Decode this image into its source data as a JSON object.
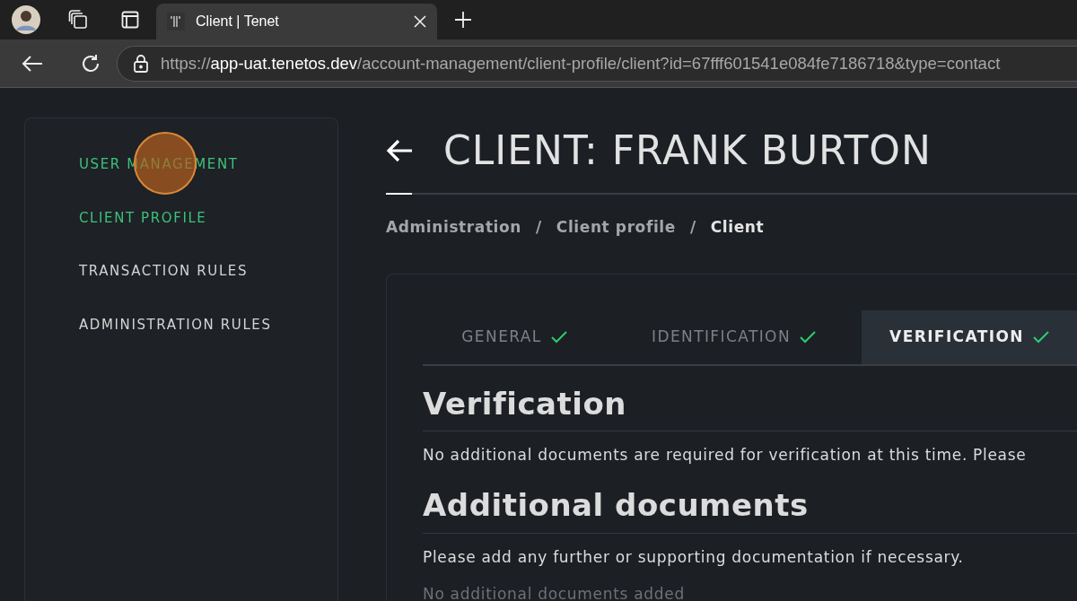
{
  "browser": {
    "tab_title": "Client | Tenet",
    "url": {
      "scheme": "https://",
      "host": "app-uat.tenetos.dev",
      "path": "/account-management/client-profile/client?id=67fff601541e084fe7186718&type=contact"
    }
  },
  "sidebar": {
    "items": [
      {
        "label": "USER MANAGEMENT",
        "selected": true
      },
      {
        "label": "CLIENT PROFILE",
        "selected": true
      },
      {
        "label": "TRANSACTION RULES",
        "selected": false
      },
      {
        "label": "ADMINISTRATION RULES",
        "selected": false
      }
    ]
  },
  "page": {
    "title": "CLIENT: FRANK BURTON",
    "breadcrumb": [
      {
        "label": "Administration",
        "selected": false
      },
      {
        "label": "Client profile",
        "selected": false
      },
      {
        "label": "Client",
        "selected": true
      }
    ],
    "separator": "/"
  },
  "tabs": [
    {
      "label": "GENERAL",
      "selected": false,
      "checked": true
    },
    {
      "label": "IDENTIFICATION",
      "selected": false,
      "checked": true
    },
    {
      "label": "VERIFICATION",
      "selected": true,
      "checked": true
    }
  ],
  "sections": [
    {
      "heading": "Verification",
      "text": "No additional documents are required for verification at this time. Please"
    },
    {
      "heading": "Additional documents",
      "text": "Please add any further or supporting documentation if necessary."
    }
  ],
  "empty_note": "No additional documents added"
}
